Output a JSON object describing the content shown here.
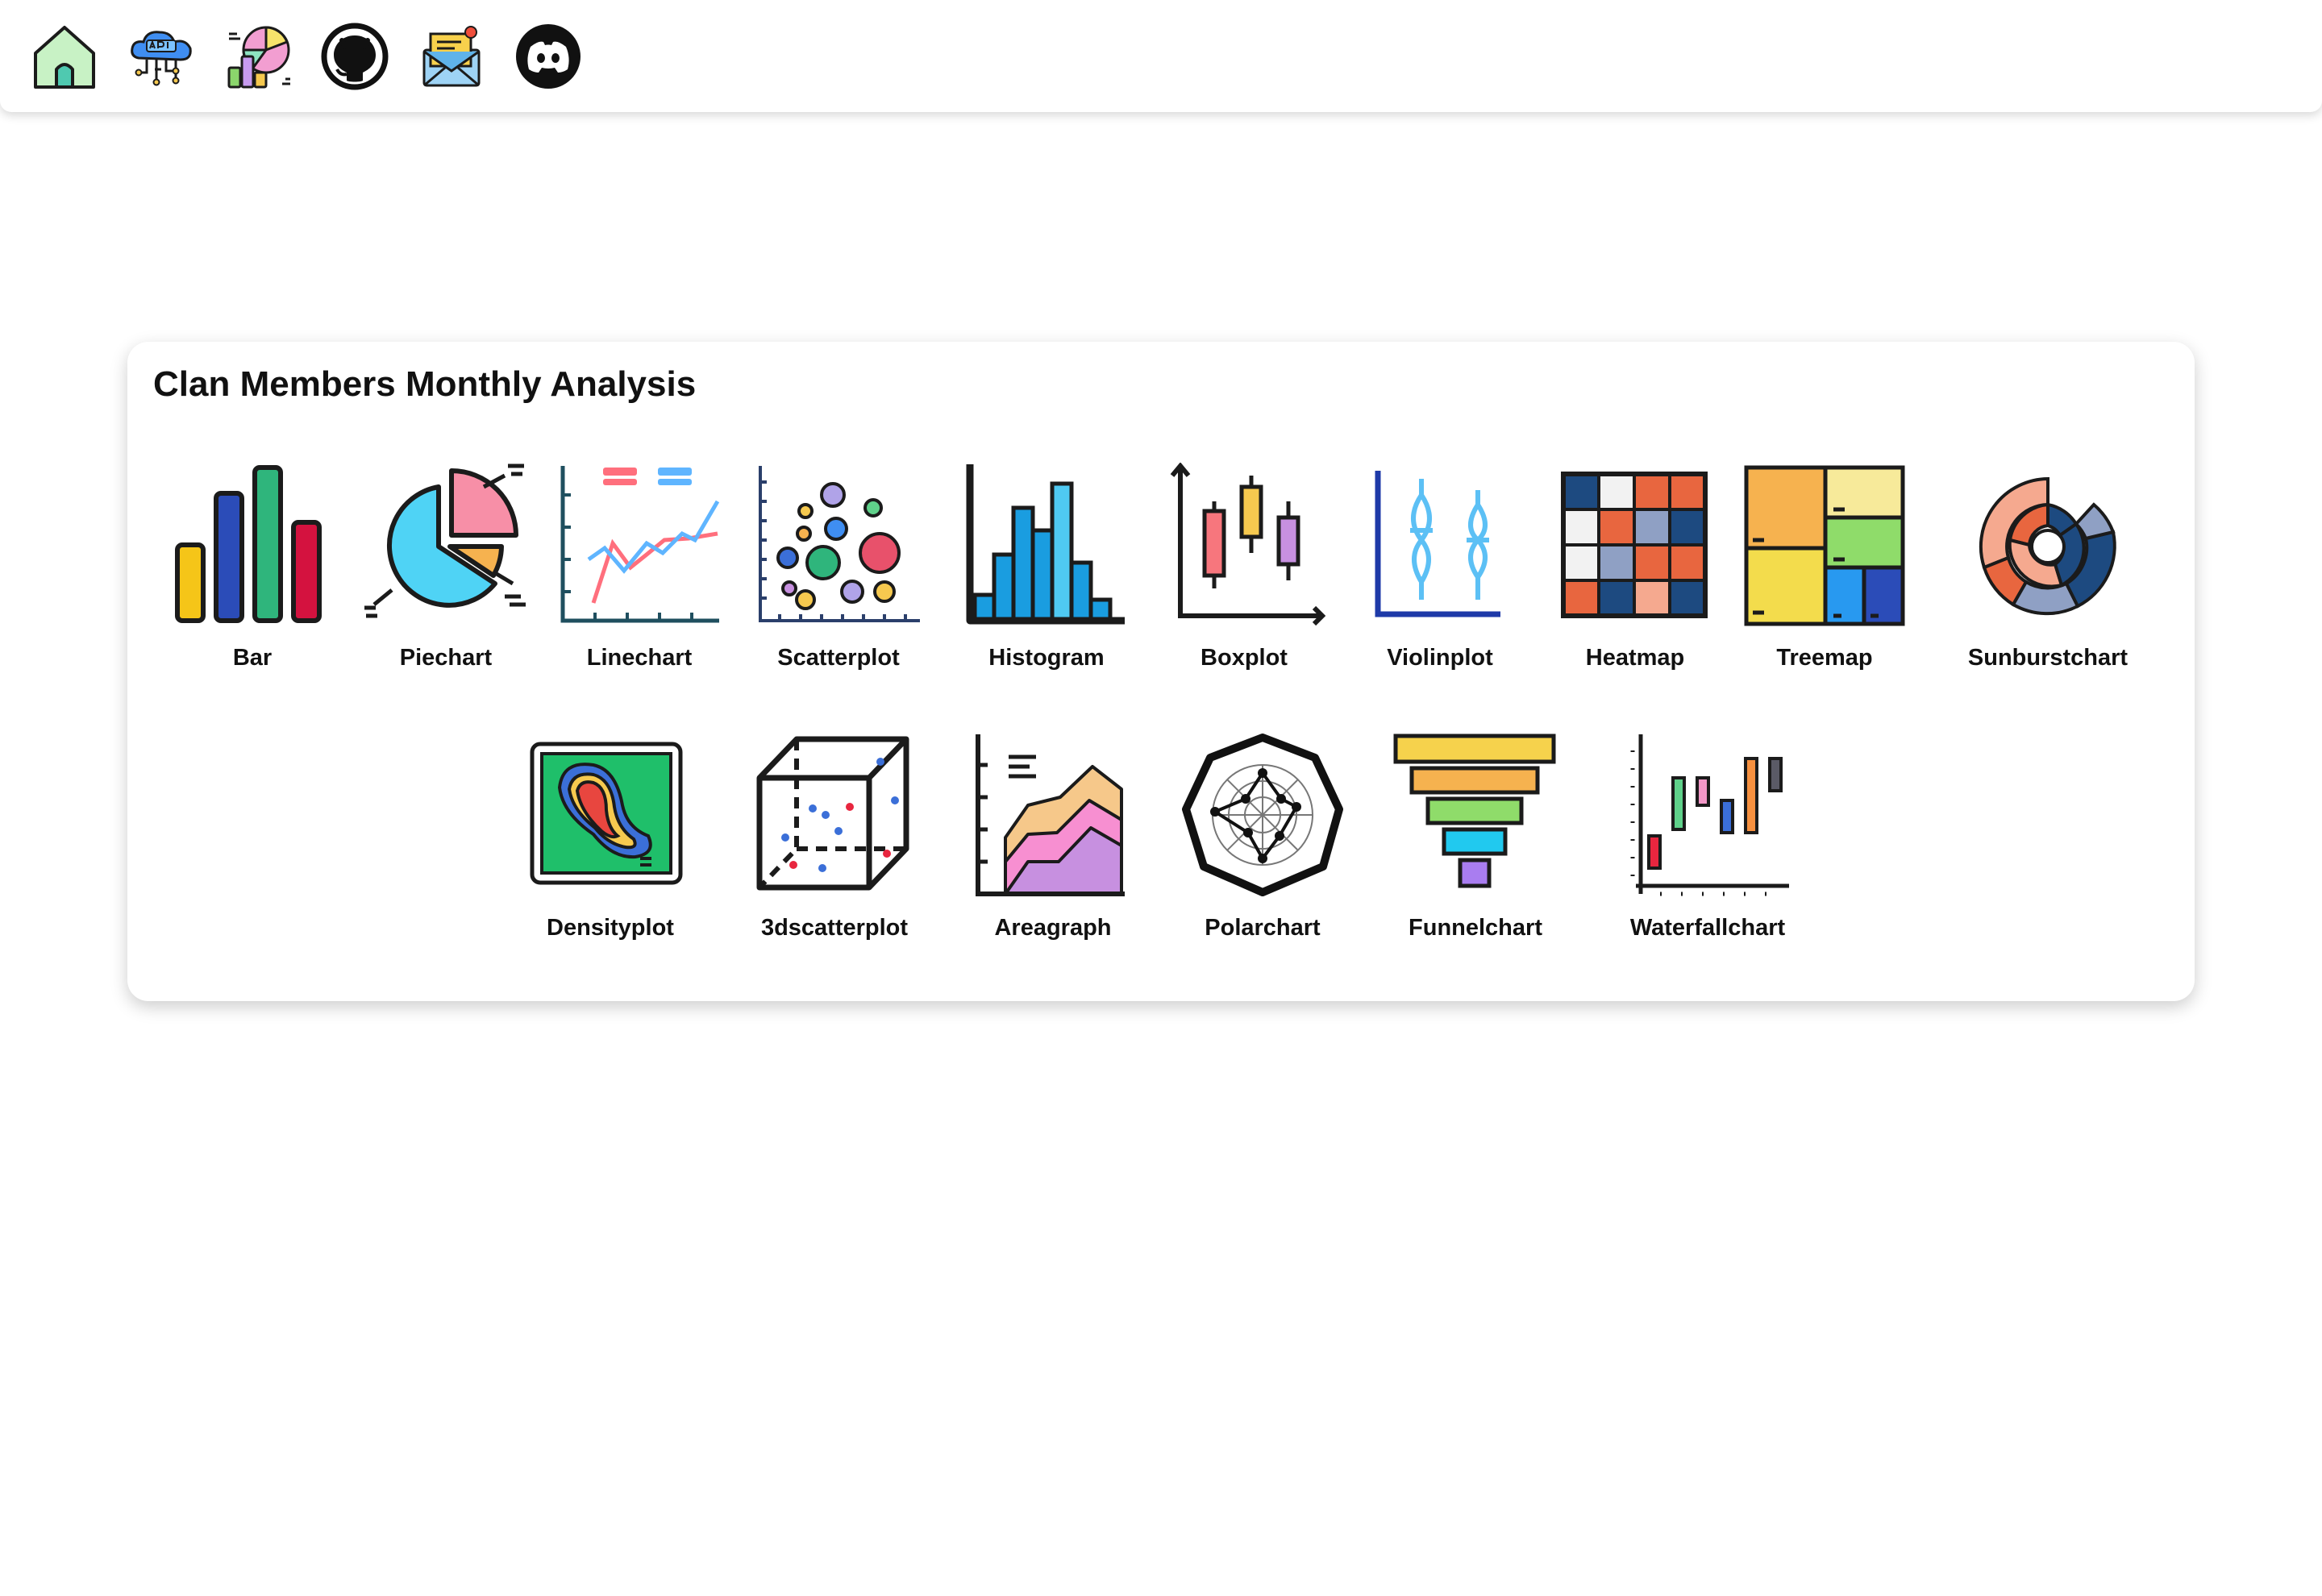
{
  "nav": {
    "items": [
      {
        "name": "home"
      },
      {
        "name": "api"
      },
      {
        "name": "charts"
      },
      {
        "name": "github"
      },
      {
        "name": "mail",
        "badge": ""
      },
      {
        "name": "discord"
      }
    ]
  },
  "card": {
    "title": "Clan Members Monthly Analysis",
    "charts": [
      {
        "label": "Bar",
        "icon": "bar-chart-icon"
      },
      {
        "label": "Piechart",
        "icon": "pie-chart-icon"
      },
      {
        "label": "Linechart",
        "icon": "line-chart-icon"
      },
      {
        "label": "Scatterplot",
        "icon": "scatter-plot-icon"
      },
      {
        "label": "Histogram",
        "icon": "histogram-icon"
      },
      {
        "label": "Boxplot",
        "icon": "boxplot-icon"
      },
      {
        "label": "Violinplot",
        "icon": "violin-plot-icon"
      },
      {
        "label": "Heatmap",
        "icon": "heatmap-icon"
      },
      {
        "label": "Treemap",
        "icon": "treemap-icon"
      },
      {
        "label": "Sunburstchart",
        "icon": "sunburst-chart-icon"
      },
      {
        "label": "Densityplot",
        "icon": "density-plot-icon"
      },
      {
        "label": "3dscatterplot",
        "icon": "3d-scatter-plot-icon"
      },
      {
        "label": "Areagraph",
        "icon": "area-graph-icon"
      },
      {
        "label": "Polarchart",
        "icon": "polar-chart-icon"
      },
      {
        "label": "Funnelchart",
        "icon": "funnel-chart-icon"
      },
      {
        "label": "Waterfallchart",
        "icon": "waterfall-chart-icon"
      }
    ]
  },
  "colors": {
    "text": "#111111",
    "outline": "#1b1b1b",
    "yellow": "#f5c518",
    "blue": "#2b4cb8",
    "green": "#2fb57c",
    "red": "#d4123f",
    "cyan": "#4fd3f5",
    "pink": "#f78fa7",
    "orange": "#f6b24f",
    "purple": "#c790e0",
    "navy": "#1d4a80",
    "coral": "#e8663f"
  }
}
